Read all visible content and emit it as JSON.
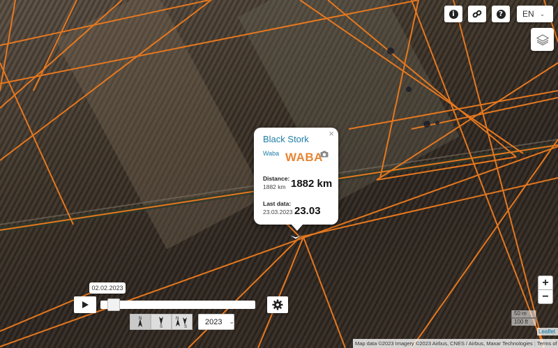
{
  "toolbar": {
    "info_icon": "info-icon",
    "link_icon": "link-icon",
    "help_icon": "help-icon",
    "language": "EN"
  },
  "map": {
    "track_color": "#e6781f",
    "layers_icon": "layers-icon"
  },
  "popup": {
    "title": "Black Stork",
    "organization": "Waba",
    "logo_text": "WABA",
    "close": "×",
    "distance_label": "Distance:",
    "distance_small": "1882 km",
    "distance_big": "1882 km",
    "last_data_label": "Last data:",
    "last_data_small": "23.03.2023",
    "last_data_big": "23.03"
  },
  "playback": {
    "date_tooltip": "02.02.2023",
    "position_fraction": 0.05,
    "year": "2023",
    "direction_buttons": [
      {
        "name": "north",
        "top": "N",
        "bottom": ""
      },
      {
        "name": "south",
        "top": "",
        "bottom": "S"
      },
      {
        "name": "north-south",
        "top": "N",
        "bottom": "S"
      }
    ]
  },
  "map_controls": {
    "zoom_in": "+",
    "zoom_out": "−",
    "scale_metric": "50 m",
    "scale_imperial": "100 ft"
  },
  "footer": {
    "leaflet": "Leaflet",
    "attribution": "Map data ©2023 Imagery ©2023 Airbus, CNES / Airbus, Maxar Technologies",
    "terms": "Terms of Use"
  }
}
